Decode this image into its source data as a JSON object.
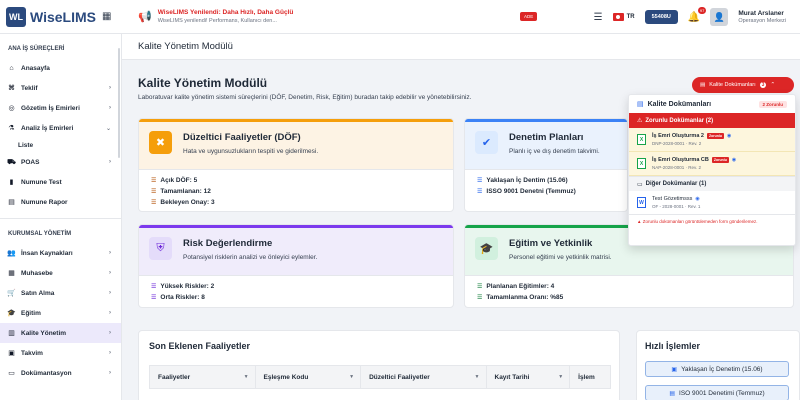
{
  "app": {
    "logo_mark": "WL",
    "logo_text": "WiseLIMS",
    "announcement_title": "WiseLIMS Yenilendi: Daha Hızlı, Daha Güçlü",
    "announcement_sub": "WiseLIMS yenilendi! Performans, Kullanıcı den...",
    "new_badge": "ADE",
    "language": "TR",
    "session_btn": "55408U",
    "notif_count": "97",
    "user_name": "Murat Arslaner",
    "user_role": "Operasyon Merkezi"
  },
  "sidebar": {
    "section1": "ANA İŞ SÜREÇLERİ",
    "items1": [
      {
        "label": "Anasayfa",
        "icon": "home-icon"
      },
      {
        "label": "Teklif",
        "icon": "tag-icon"
      },
      {
        "label": "Gözetim İş Emirleri",
        "icon": "binoculars-icon"
      },
      {
        "label": "Analiz İş Emirleri",
        "icon": "flask-icon"
      }
    ],
    "sub_liste": "Liste",
    "items1b": [
      {
        "label": "POAS",
        "icon": "truck-icon"
      },
      {
        "label": "Numune Test",
        "icon": "vial-icon"
      },
      {
        "label": "Numune Rapor",
        "icon": "file-icon"
      }
    ],
    "section2": "KURUMSAL YÖNETİM",
    "items2": [
      {
        "label": "İnsan Kaynakları",
        "icon": "users-icon"
      },
      {
        "label": "Muhasebe",
        "icon": "calculator-icon"
      },
      {
        "label": "Satın Alma",
        "icon": "cart-icon"
      },
      {
        "label": "Eğitim",
        "icon": "graduation-icon"
      },
      {
        "label": "Kalite Yönetim",
        "icon": "chart-icon"
      },
      {
        "label": "Takvim",
        "icon": "calendar-icon"
      },
      {
        "label": "Dokümantasyon",
        "icon": "folder-icon"
      }
    ]
  },
  "page": {
    "header": "Kalite Yönetim Modülü",
    "title": "Kalite Yönetim Modülü",
    "description": "Laboratuvar kalite yönetim sistemi süreçlerini (DÖF, Denetim, Risk, Eğitim) buradan takip edebilir ve yönetebilirsiniz.",
    "docs_button": "Kalite Dokümanları",
    "docs_count": "3"
  },
  "cards": {
    "dof": {
      "title": "Düzeltici Faaliyetler (DÖF)",
      "sub": "Hata ve uygunsuzlukların tespiti ve giderilmesi.",
      "stats": [
        "Açık DÖF: 5",
        "Tamamlanan: 12",
        "Bekleyen Onay: 3"
      ]
    },
    "denetim": {
      "title": "Denetim Planları",
      "sub": "Planlı iç ve dış denetim takvimi.",
      "stats": [
        "Yaklaşan İç Dentim (15.06)",
        "ISSO 9001 Denetni (Temmuz)"
      ]
    },
    "risk": {
      "title": "Risk Değerlendirme",
      "sub": "Potansiyel risklerin analizi ve önleyici eylemler.",
      "stats": [
        "Yüksek Riskler: 2",
        "Orta Riskler: 8"
      ]
    },
    "egitim": {
      "title": "Eğitim ve Yetkinlik",
      "sub": "Personel eğitimi ve yetkinlik matrisi.",
      "stats": [
        "Planlanan Eğitimler: 4",
        "Tamamlanma Oranı: %85"
      ]
    }
  },
  "dropdown": {
    "title": "Kalite Dokümanları",
    "req_badge": "2 Zorunlu",
    "required_section": "Zorunlu Dokümanlar (2)",
    "required_docs": [
      {
        "name": "İş Emri Oluşturma 2",
        "code": "DNP-2028-0001 · Rev. 2",
        "tag": "Zorunlu"
      },
      {
        "name": "İş Emri Oluşturma CB",
        "code": "NAP-2028-0001 · Rev. 2",
        "tag": "Zorunlu"
      }
    ],
    "other_section": "Diğer Dokümanlar (1)",
    "other_docs": [
      {
        "name": "Test Gözetimsss",
        "code": "OF - 2028-0001 · Rev. 1"
      }
    ],
    "warning": "Zorunlu dokümanları görüntülemeden form gönderilemez."
  },
  "recent": {
    "title": "Son Eklenen Faaliyetler",
    "columns": [
      "Faaliyetler",
      "Eşleşme Kodu",
      "Düzeltici Faaliyetler",
      "Kayıt Tarihi",
      "İşlem"
    ]
  },
  "quick": {
    "title": "Hızlı İşlemler",
    "buttons": [
      "Yaklaşan İç Denetim (15.06)",
      "ISO 9001 Denetimi (Temmuz)"
    ]
  },
  "colors": {
    "brand": "#2b4a7e",
    "danger": "#dc2626",
    "dof": "#f59e0b",
    "denetim": "#3b82f6",
    "risk": "#7c3aed",
    "egitim": "#16a34a"
  }
}
